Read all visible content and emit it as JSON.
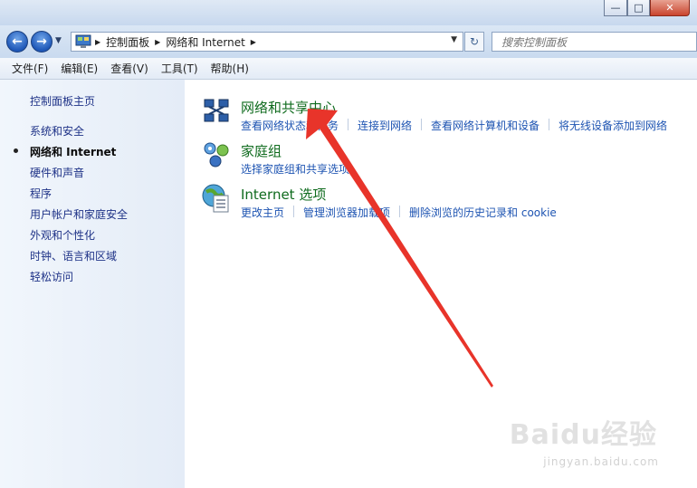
{
  "address": {
    "crumbs": [
      "控制面板",
      "网络和 Internet"
    ]
  },
  "search": {
    "placeholder": "搜索控制面板"
  },
  "menu": [
    "文件(F)",
    "编辑(E)",
    "查看(V)",
    "工具(T)",
    "帮助(H)"
  ],
  "sidebar": {
    "home": "控制面板主页",
    "items": [
      "系统和安全",
      "网络和 Internet",
      "硬件和声音",
      "程序",
      "用户帐户和家庭安全",
      "外观和个性化",
      "时钟、语言和区域",
      "轻松访问"
    ],
    "active_index": 1
  },
  "categories": [
    {
      "title": "网络和共享中心",
      "icon": "network-sharing-center-icon",
      "links": [
        "查看网络状态和任务",
        "连接到网络",
        "查看网络计算机和设备",
        "将无线设备添加到网络"
      ]
    },
    {
      "title": "家庭组",
      "icon": "homegroup-icon",
      "links": [
        "选择家庭组和共享选项"
      ]
    },
    {
      "title": "Internet 选项",
      "icon": "internet-options-icon",
      "links": [
        "更改主页",
        "管理浏览器加载项",
        "删除浏览的历史记录和 cookie"
      ]
    }
  ],
  "window_buttons": {
    "minimize": "—",
    "maximize": "□",
    "close": "✕"
  },
  "watermark": {
    "brand": "Baidu经验",
    "url": "jingyan.baidu.com"
  },
  "colors": {
    "link": "#1e54b2",
    "category_title": "#0f6b1e",
    "annotation_arrow": "#e8342a"
  }
}
